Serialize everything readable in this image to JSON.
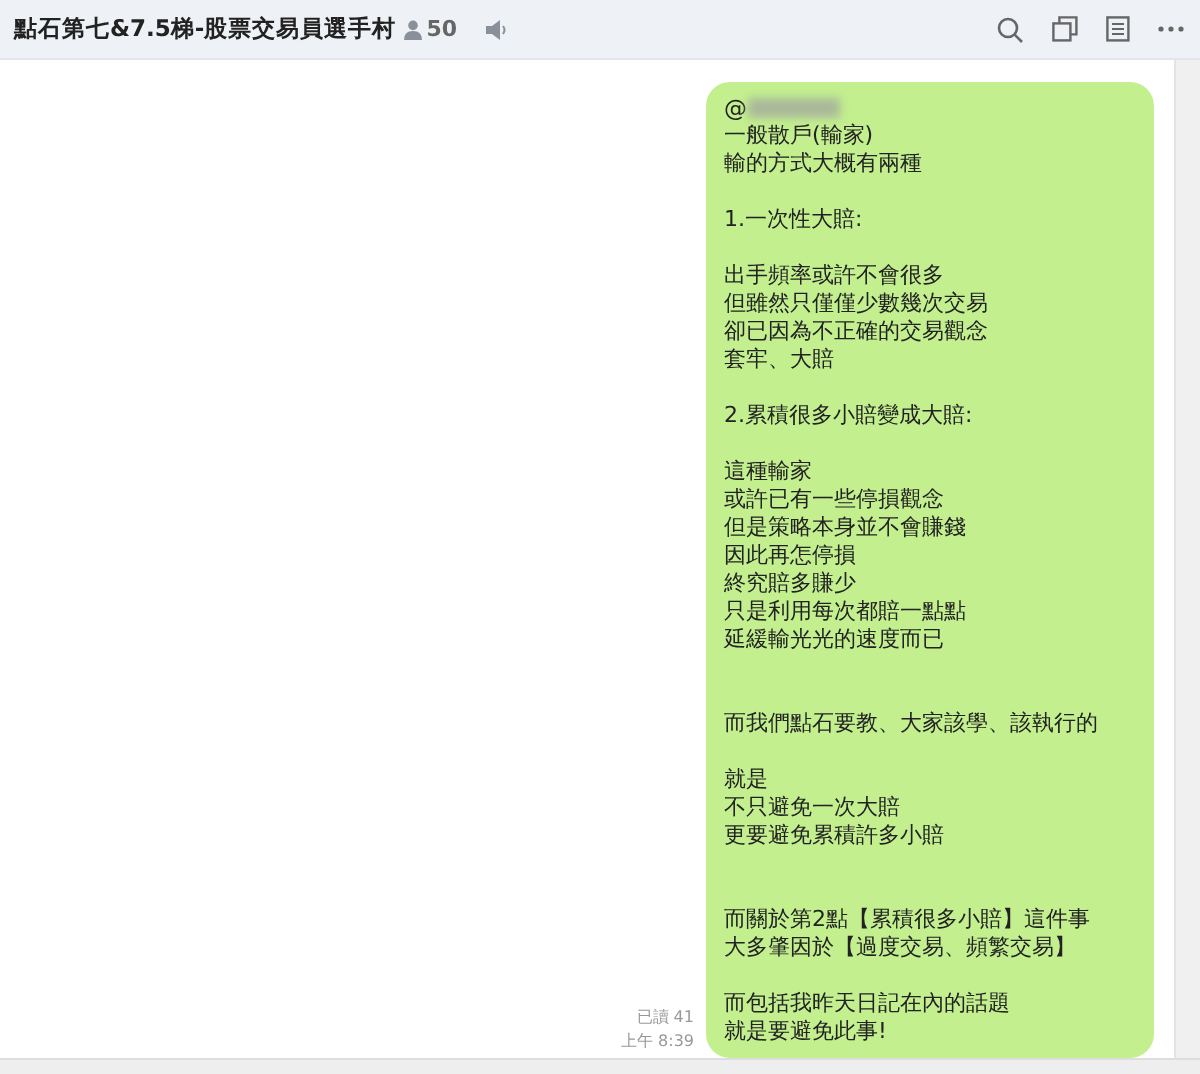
{
  "header": {
    "title": "點石第七&7.5梯-股票交易員選手村",
    "member_count": "50"
  },
  "message": {
    "mention": "@",
    "sections": [
      {
        "paragraphs": [
          {
            "lines": [
              "一般散戶(輸家)",
              "輸的方式大概有兩種"
            ]
          },
          {
            "lines": [
              "1.一次性大賠:"
            ]
          },
          {
            "lines": [
              "出手頻率或許不會很多",
              "但雖然只僅僅少數幾次交易",
              "卻已因為不正確的交易觀念",
              "套牢、大賠"
            ]
          },
          {
            "lines": [
              "2.累積很多小賠變成大賠:"
            ]
          },
          {
            "lines": [
              "這種輸家",
              "或許已有一些停損觀念",
              "但是策略本身並不會賺錢",
              "因此再怎停損",
              "終究賠多賺少",
              "只是利用每次都賠一點點",
              "延緩輸光光的速度而已"
            ]
          }
        ]
      },
      {
        "paragraphs": [
          {
            "lines": [
              "而我們點石要教、大家該學、該執行的"
            ]
          },
          {
            "lines": [
              "就是",
              "不只避免一次大賠",
              "更要避免累積許多小賠"
            ]
          }
        ]
      },
      {
        "paragraphs": [
          {
            "lines": [
              "而關於第2點【累積很多小賠】這件事",
              "大多肇因於【過度交易、頻繁交易】"
            ]
          },
          {
            "lines": [
              "而包括我昨天日記在內的話題",
              "就是要避免此事!"
            ]
          }
        ]
      }
    ],
    "read": "已讀 41",
    "time": "上午 8:39"
  }
}
